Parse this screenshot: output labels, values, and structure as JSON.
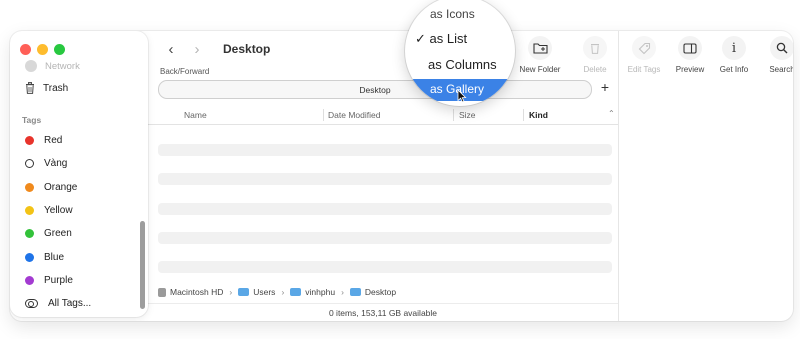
{
  "window": {
    "title": "Desktop"
  },
  "sidebar": {
    "network_label": "Network",
    "trash_label": "Trash",
    "tags_heading": "Tags",
    "tags": [
      {
        "label": "Red",
        "color": "#e8342c",
        "style": "filled"
      },
      {
        "label": "Vàng",
        "color": "#333333",
        "style": "hollow"
      },
      {
        "label": "Orange",
        "color": "#f08a1d",
        "style": "filled"
      },
      {
        "label": "Yellow",
        "color": "#f3c316",
        "style": "filled"
      },
      {
        "label": "Green",
        "color": "#33c23a",
        "style": "filled"
      },
      {
        "label": "Blue",
        "color": "#1f74e8",
        "style": "filled"
      },
      {
        "label": "Purple",
        "color": "#a33bd1",
        "style": "filled"
      }
    ],
    "all_tags_label": "All Tags..."
  },
  "toolbar": {
    "back_forward_label": "Back/Forward",
    "new_folder_label": "New Folder",
    "delete_label": "Delete",
    "edit_tags_label": "Edit Tags",
    "preview_label": "Preview",
    "get_info_label": "Get Info",
    "search_label": "Search"
  },
  "pathbar": {
    "label": "Desktop"
  },
  "columns": {
    "name": "Name",
    "date_modified": "Date Modified",
    "size": "Size",
    "kind": "Kind"
  },
  "breadcrumbs": [
    "Macintosh HD",
    "Users",
    "vinhphu",
    "Desktop"
  ],
  "status": {
    "text": "0 items, 153,11 GB available"
  },
  "view_menu": {
    "items": [
      {
        "label": "as Icons",
        "checked": false,
        "highlighted": false
      },
      {
        "label": "as List",
        "checked": true,
        "highlighted": false
      },
      {
        "label": "as Columns",
        "checked": false,
        "highlighted": false
      },
      {
        "label": "as Gallery",
        "checked": false,
        "highlighted": true
      }
    ],
    "checkmark": "✓"
  }
}
